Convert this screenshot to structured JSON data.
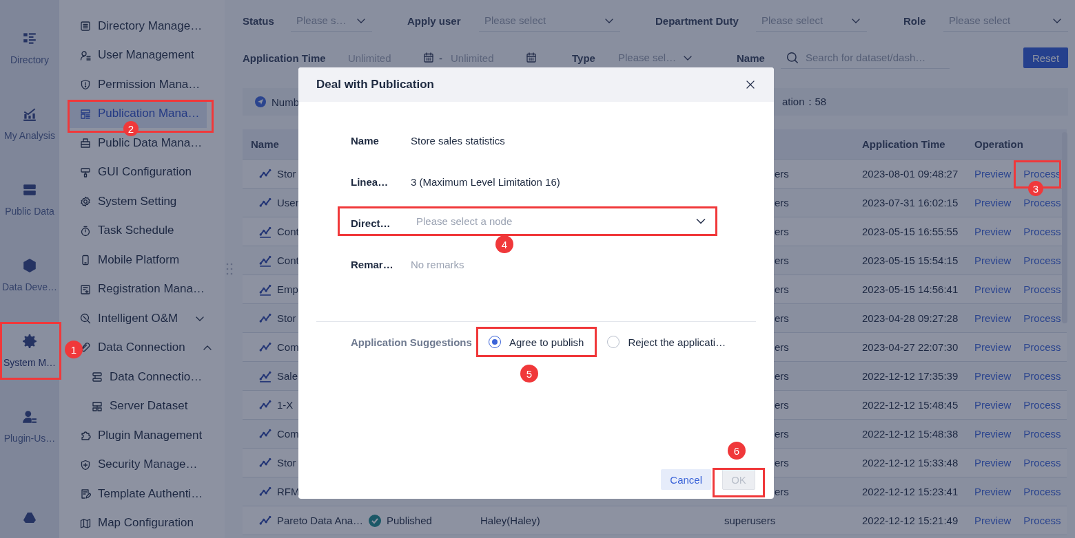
{
  "rail": {
    "items": [
      {
        "label": "Directory",
        "selected": false
      },
      {
        "label": "My Analysis",
        "selected": false
      },
      {
        "label": "Public Data",
        "selected": false
      },
      {
        "label": "Data Deve…",
        "selected": false
      },
      {
        "label": "System M…",
        "selected": true
      },
      {
        "label": "Plugin-Us…",
        "selected": false
      }
    ]
  },
  "menu": {
    "items": [
      {
        "label": "Directory Manage…",
        "selected": false
      },
      {
        "label": "User Management",
        "selected": false
      },
      {
        "label": "Permission Mana…",
        "selected": false
      },
      {
        "label": "Publication Mana…",
        "selected": true
      },
      {
        "label": "Public Data Mana…",
        "selected": false
      },
      {
        "label": "GUI Configuration",
        "selected": false
      },
      {
        "label": "System Setting",
        "selected": false
      },
      {
        "label": "Task Schedule",
        "selected": false
      },
      {
        "label": "Mobile Platform",
        "selected": false
      },
      {
        "label": "Registration Mana…",
        "selected": false
      },
      {
        "label": "Intelligent O&M",
        "selected": false,
        "expanded": false
      },
      {
        "label": "Data Connection",
        "selected": false,
        "expanded": true,
        "children": [
          {
            "label": "Data Connectio…",
            "selected": false
          },
          {
            "label": "Server Dataset",
            "selected": false
          }
        ]
      },
      {
        "label": "Plugin Management",
        "selected": false
      },
      {
        "label": "Security Manage…",
        "selected": false
      },
      {
        "label": "Template Authenti…",
        "selected": false
      },
      {
        "label": "Map Configuration",
        "selected": false
      }
    ]
  },
  "filters": [
    {
      "label": "Status",
      "placeholder": "Please s…"
    },
    {
      "label": "Apply user",
      "placeholder": "Please select"
    },
    {
      "label": "Department Duty",
      "placeholder": "Please select"
    },
    {
      "label": "Role",
      "placeholder": "Please select"
    }
  ],
  "time_filter": {
    "label": "Application Time",
    "start_placeholder": "Unlimited",
    "separator": "-",
    "end_placeholder": "Unlimited"
  },
  "type_filter": {
    "label": "Type",
    "placeholder": "Please sel…"
  },
  "name_filter": {
    "label": "Name",
    "placeholder": "Search for dataset/dash…"
  },
  "reset_button": "Reset",
  "summary": {
    "left": "Numb",
    "right": "ation：58"
  },
  "table": {
    "columns": {
      "name": "Name",
      "time": "Application Time",
      "operation": "Operation"
    },
    "rows": [
      {
        "kind": "trend",
        "name": "Stor",
        "column_4": "ers",
        "time": "2023-08-01 09:48:27",
        "actions": [
          "Preview",
          "Process"
        ]
      },
      {
        "kind": "trend",
        "name": "User",
        "column_4": "ers",
        "time": "2023-07-31 16:02:15",
        "actions": [
          "Preview",
          "Process"
        ]
      },
      {
        "kind": "trend-axis",
        "name": "Cont",
        "column_4": "ers",
        "time": "2023-05-15 16:55:55",
        "actions": [
          "Preview",
          "Process"
        ]
      },
      {
        "kind": "trend-axis",
        "name": "Cont",
        "column_4": "ers",
        "time": "2023-05-15 15:54:15",
        "actions": [
          "Preview",
          "Process"
        ]
      },
      {
        "kind": "trend-axis",
        "name": "Emp",
        "column_4": "ers",
        "time": "2023-05-15 14:56:41",
        "actions": [
          "Preview",
          "Process"
        ]
      },
      {
        "kind": "trend",
        "name": "Stor",
        "column_4": "ers",
        "time": "2023-04-28 09:27:28",
        "actions": [
          "Preview",
          "Process"
        ]
      },
      {
        "kind": "trend",
        "name": "Com",
        "column_4": "ers",
        "time": "2023-04-27 22:07:30",
        "actions": [
          "Preview",
          "Process"
        ]
      },
      {
        "kind": "trend-axis",
        "name": "Sale",
        "column_4": "ers",
        "time": "2022-12-12 17:35:39",
        "actions": [
          "Preview",
          "Process"
        ]
      },
      {
        "kind": "trend",
        "name": "1-X",
        "column_4": "ers",
        "time": "2022-12-12 15:48:45",
        "actions": [
          "Preview",
          "Process"
        ]
      },
      {
        "kind": "trend",
        "name": "Com",
        "column_4": "ers",
        "time": "2022-12-12 15:48:38",
        "actions": [
          "Preview",
          "Process"
        ]
      },
      {
        "kind": "trend",
        "name": "Stor",
        "column_4": "ers",
        "time": "2022-12-12 15:33:48",
        "actions": [
          "Preview",
          "Process"
        ]
      },
      {
        "kind": "trend",
        "name": "RFM",
        "column_4": "ers",
        "time": "2022-12-12 15:23:41",
        "actions": [
          "Preview",
          "Process"
        ]
      },
      {
        "kind": "trend",
        "name": "Pareto Data Ana…",
        "column_2": "Published",
        "column_3": "Haley(Haley)",
        "column_4": "superusers",
        "time": "2022-12-12 15:21:49",
        "actions": [
          "Preview",
          "Process"
        ]
      }
    ]
  },
  "dialog": {
    "title": "Deal with Publication",
    "fields": [
      {
        "kind": "text",
        "label": "Name",
        "value": "Store sales statistics"
      },
      {
        "kind": "text",
        "label": "Linea…",
        "value": "3 (Maximum Level Limitation 16)"
      },
      {
        "kind": "select",
        "label": "Direct…",
        "placeholder": "Please select a node"
      },
      {
        "kind": "note",
        "label": "Remar…",
        "value": "No remarks"
      }
    ],
    "suggestions": {
      "label": "Application Suggestions",
      "options": [
        {
          "label": "Agree to publish",
          "selected": true
        },
        {
          "label": "Reject the applicati…",
          "selected": false
        }
      ]
    },
    "buttons": [
      {
        "label": "Cancel",
        "disabled": false
      },
      {
        "label": "OK",
        "disabled": true
      }
    ]
  },
  "annotations": [
    {
      "number": "1"
    },
    {
      "number": "2"
    },
    {
      "number": "3"
    },
    {
      "number": "4"
    },
    {
      "number": "5"
    },
    {
      "number": "6"
    }
  ]
}
